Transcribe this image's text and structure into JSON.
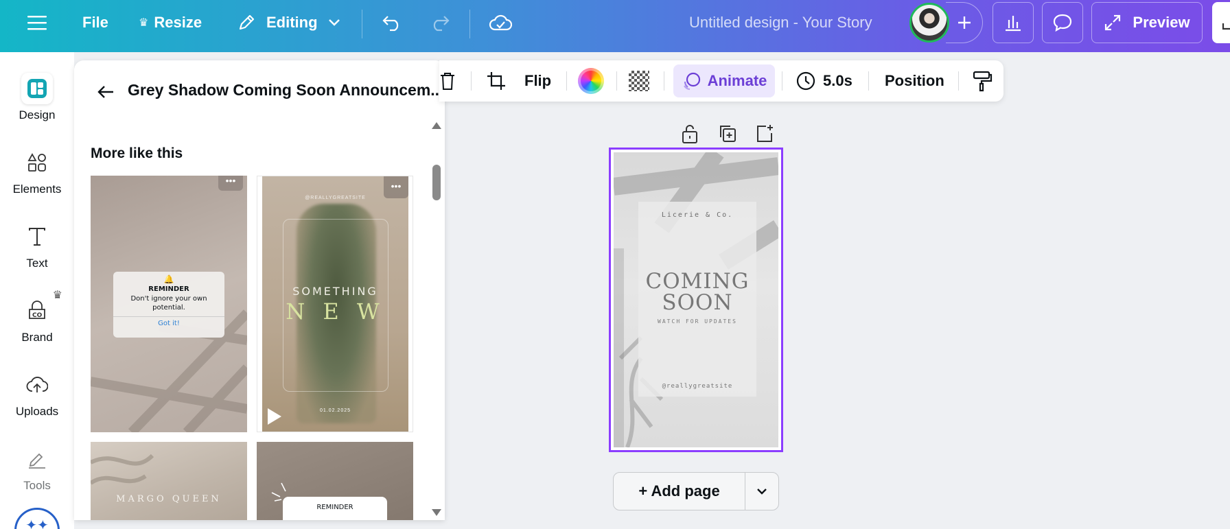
{
  "topbar": {
    "file_label": "File",
    "resize_label": "Resize",
    "editing_label": "Editing",
    "design_title": "Untitled design - Your Story",
    "preview_label": "Preview"
  },
  "rail": {
    "items": [
      {
        "label": "Design"
      },
      {
        "label": "Elements"
      },
      {
        "label": "Text"
      },
      {
        "label": "Brand"
      },
      {
        "label": "Uploads"
      },
      {
        "label": "Tools"
      }
    ]
  },
  "panel": {
    "title": "Grey Shadow Coming Soon Announcem...",
    "section_title": "More like this",
    "thumbs": {
      "reminder1": {
        "title": "REMINDER",
        "body": "Don't ignore your own potential.",
        "action": "Got it!"
      },
      "something_new": {
        "handle": "@REALLYGREATSITE",
        "line1": "SOMETHING",
        "line2": "N E W",
        "date": "01.02.2025"
      },
      "margo": {
        "text": "MARGO QUEEN"
      },
      "reminder2": {
        "title": "REMINDER"
      }
    }
  },
  "toolbar": {
    "flip_label": "Flip",
    "animate_label": "Animate",
    "duration_label": "5.0s",
    "position_label": "Position"
  },
  "design": {
    "brand": "Licerie & Co.",
    "headline1": "COMING",
    "headline2": "SOON",
    "subline": "WATCH FOR UPDATES",
    "handle": "@reallygreatsite"
  },
  "add_page_label": "+ Add page",
  "colors": {
    "accent": "#8b3dff",
    "animate": "#6c3fd6"
  }
}
